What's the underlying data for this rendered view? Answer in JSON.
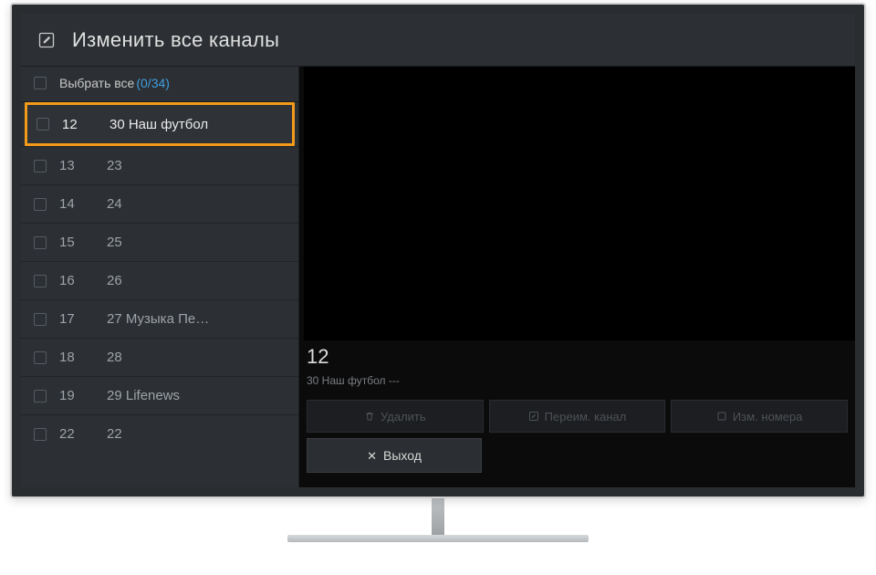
{
  "header": {
    "title": "Изменить все каналы"
  },
  "selectAll": {
    "label": "Выбрать все",
    "count": "(0/34)"
  },
  "channels": [
    {
      "num": "12",
      "name": "30 Наш футбол",
      "selected": true
    },
    {
      "num": "13",
      "name": "23"
    },
    {
      "num": "14",
      "name": "24"
    },
    {
      "num": "15",
      "name": "25"
    },
    {
      "num": "16",
      "name": "26"
    },
    {
      "num": "17",
      "name": "27 Музыка Пе…"
    },
    {
      "num": "18",
      "name": "28"
    },
    {
      "num": "19",
      "name": "29 Lifenews"
    },
    {
      "num": "22",
      "name": "22"
    }
  ],
  "selectedInfo": {
    "num": "12",
    "name": "30 Наш футбол ---"
  },
  "actions": {
    "delete": "Удалить",
    "rename": "Переим. канал",
    "renumber": "Изм. номера",
    "exit": "Выход"
  }
}
